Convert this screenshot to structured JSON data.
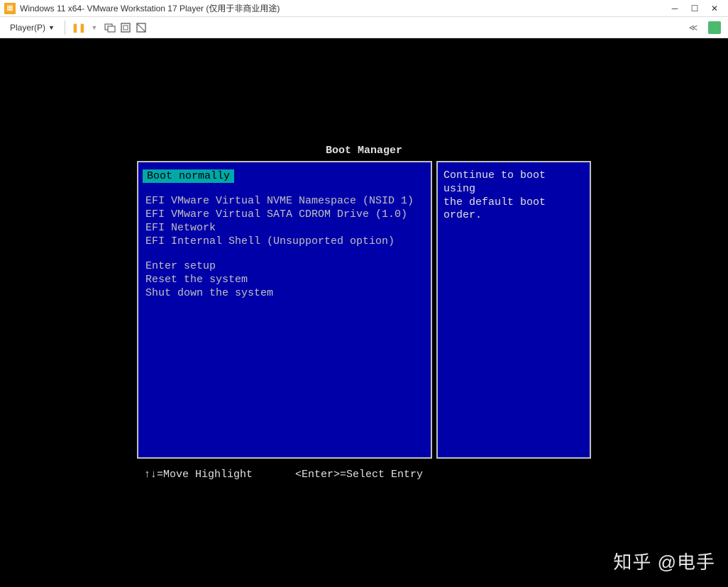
{
  "window": {
    "title": "Windows 11 x64- VMware Workstation 17 Player (仅用于非商业用途)"
  },
  "toolbar": {
    "player_label": "Player(P)",
    "icons": {
      "pause": "pause",
      "dropdown": "▼",
      "send_keys": "send-ctrl-alt-del",
      "fullscreen": "fullscreen",
      "unity": "unity",
      "back": "≪",
      "note": "note"
    }
  },
  "boot": {
    "title": "Boot Manager",
    "selected": "Boot normally",
    "items_group1": [
      "EFI VMware Virtual NVME Namespace (NSID 1)",
      "EFI VMware Virtual SATA CDROM Drive (1.0)",
      "EFI Network",
      "EFI Internal Shell (Unsupported option)"
    ],
    "items_group2": [
      "Enter setup",
      "Reset the system",
      "Shut down the system"
    ],
    "help_line1": "Continue to boot using",
    "help_line2": "the default boot order.",
    "footer_move": "↑↓=Move Highlight",
    "footer_select": "<Enter>=Select Entry"
  },
  "watermark": "知乎 @电手"
}
